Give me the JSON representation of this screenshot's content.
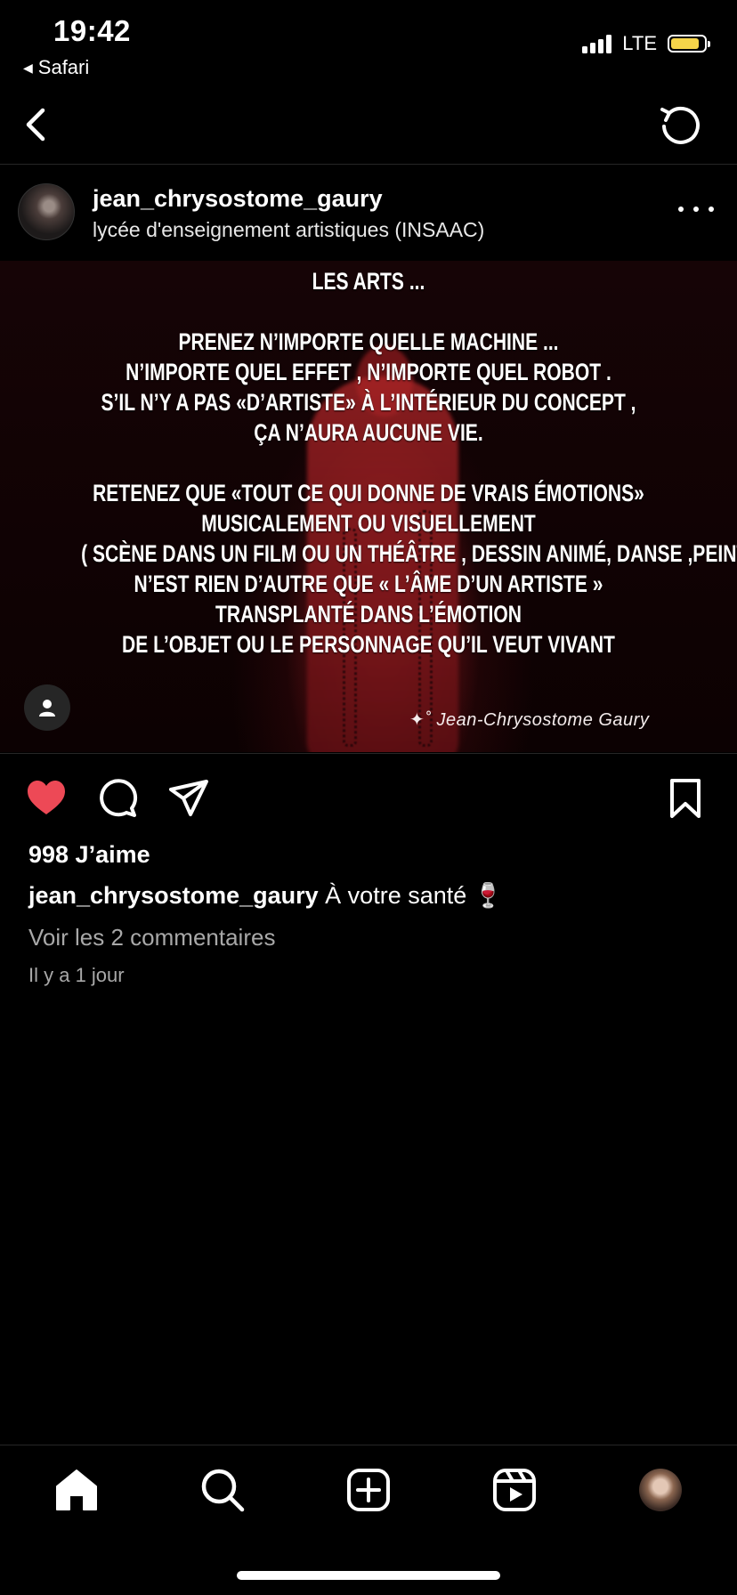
{
  "status_bar": {
    "time": "19:42",
    "back_app": "Safari",
    "network": "LTE",
    "battery_color": "#f6d54a",
    "battery_level": 0.85
  },
  "nav": {
    "back_icon": "chevron-left-icon",
    "refresh_icon": "refresh-icon"
  },
  "post": {
    "username": "jean_chrysostome_gaury",
    "location": "lycée d'enseignement artistiques (INSAAC)",
    "image": {
      "title": "LES ARTS ...",
      "paragraph1": [
        "PRENEZ N’IMPORTE QUELLE MACHINE ...",
        "N’IMPORTE QUEL EFFET , N’IMPORTE QUEL ROBOT .",
        "S’IL N’Y A PAS «D’ARTISTE» À L’INTÉRIEUR DU CONCEPT ,",
        "ÇA N’AURA AUCUNE VIE."
      ],
      "paragraph2": [
        "RETENEZ QUE «TOUT CE QUI DONNE DE VRAIS ÉMOTIONS»",
        "MUSICALEMENT OU  VISUELLEMENT",
        "( SCÈNE DANS UN FILM OU UN THÉÂTRE , DESSIN ANIMÉ, DANSE ,PEINTURE ETC )",
        "N’EST RIEN D’AUTRE QUE « L’ÂME D’UN ARTISTE »",
        "TRANSPLANTÉ DANS L’ÉMOTION",
        "DE L’OBJET OU LE PERSONNAGE QU’IL VEUT VIVANT"
      ],
      "signature": "✦˚ Jean-Chrysostome Gaury"
    },
    "likes": "998 J’aime",
    "caption_user": "jean_chrysostome_gaury",
    "caption_text": "À votre santé 🍷",
    "comments_link": "Voir les 2 commentaires",
    "time_ago": "Il y a 1 jour",
    "liked": true,
    "like_color": "#ed4956"
  },
  "tab_bar": {
    "items": [
      "home-icon",
      "search-icon",
      "new-post-icon",
      "reels-icon",
      "profile-avatar"
    ]
  }
}
